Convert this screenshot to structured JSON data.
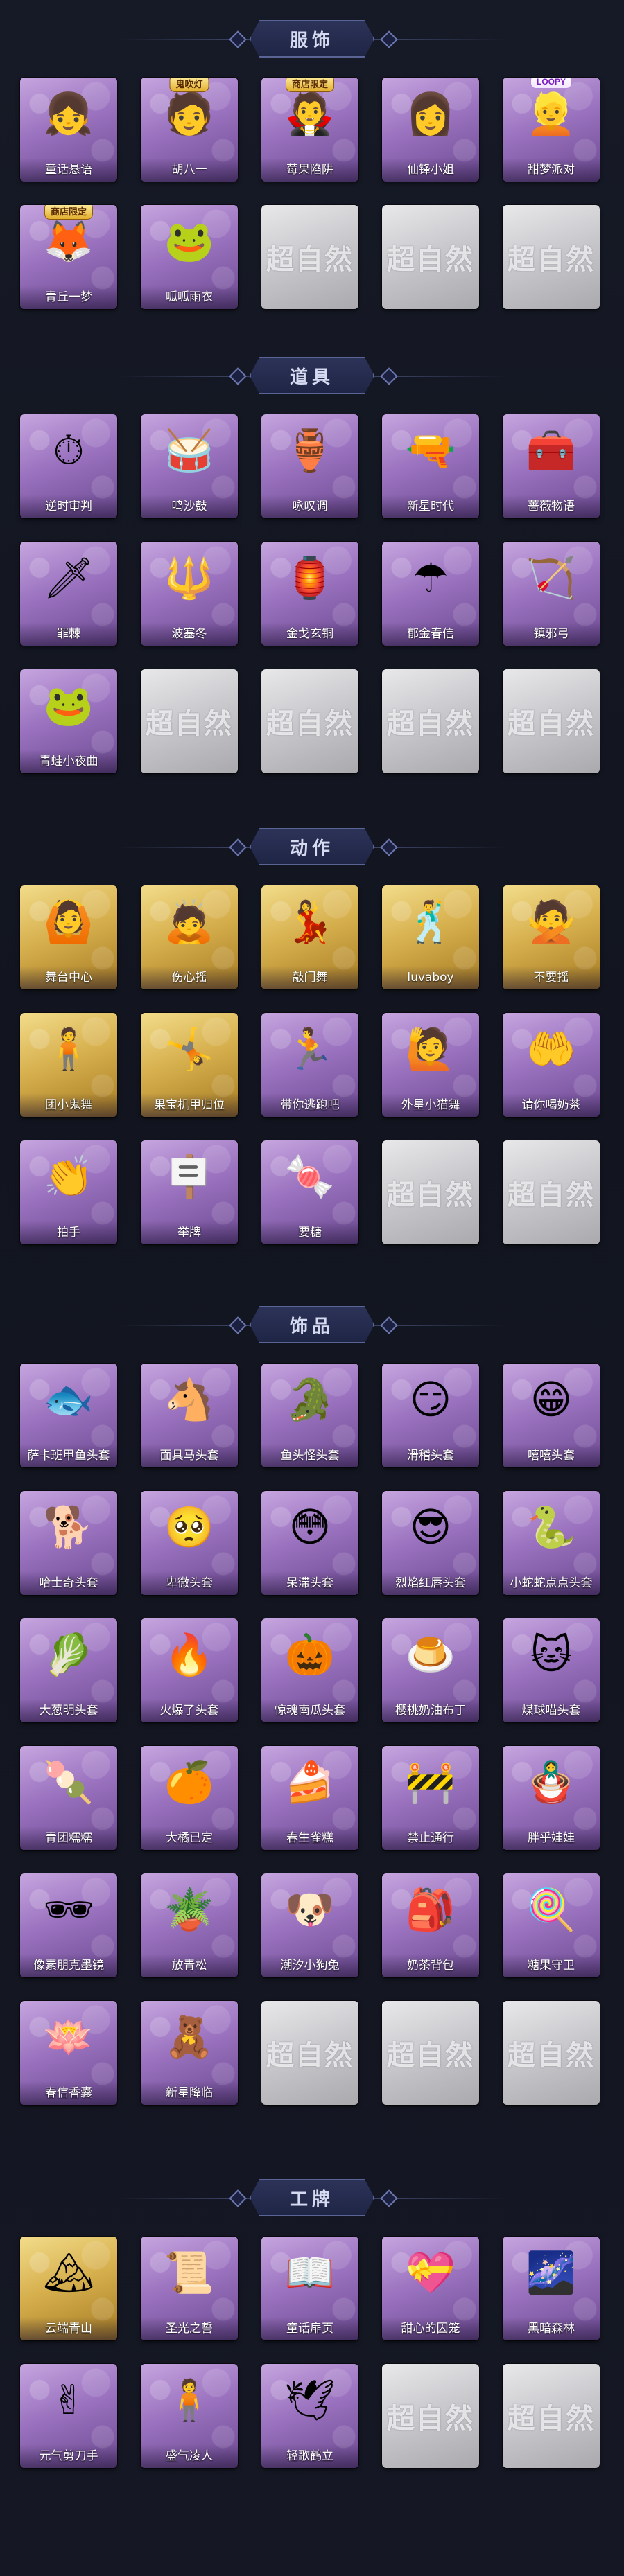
{
  "watermark": "超自然",
  "sections": [
    {
      "title": "服饰",
      "items": [
        {
          "label": "童话悬语",
          "style": "purple",
          "icon": "girl-portrait-icon",
          "glyph": "👧"
        },
        {
          "label": "胡八一",
          "style": "purple",
          "icon": "man-portrait-icon",
          "glyph": "🧑",
          "badge": "鬼吹灯"
        },
        {
          "label": "莓果陷阱",
          "style": "purple",
          "icon": "hooded-portrait-icon",
          "glyph": "🧛",
          "badge": "商店限定"
        },
        {
          "label": "仙锋小姐",
          "style": "purple",
          "icon": "lady-portrait-icon",
          "glyph": "👩"
        },
        {
          "label": "甜梦派对",
          "style": "purple",
          "icon": "party-girl-portrait-icon",
          "glyph": "👱",
          "badge": "LOOPY"
        },
        {
          "label": "青丘一梦",
          "style": "purple",
          "icon": "fox-girl-portrait-icon",
          "glyph": "🦊",
          "badge": "商店限定"
        },
        {
          "label": "呱呱雨衣",
          "style": "purple",
          "icon": "raincoat-portrait-icon",
          "glyph": "🐸"
        },
        {
          "label": "",
          "style": "empty"
        },
        {
          "label": "",
          "style": "empty"
        },
        {
          "label": "",
          "style": "empty"
        }
      ]
    },
    {
      "title": "道具",
      "items": [
        {
          "label": "逆时审判",
          "style": "purple",
          "icon": "clock-icon",
          "glyph": "⏱"
        },
        {
          "label": "鸣沙鼓",
          "style": "purple",
          "icon": "drum-icon",
          "glyph": "🥁"
        },
        {
          "label": "咏叹调",
          "style": "purple",
          "icon": "music-box-icon",
          "glyph": "🏺"
        },
        {
          "label": "新星时代",
          "style": "purple",
          "icon": "revolver-icon",
          "glyph": "🔫"
        },
        {
          "label": "蔷薇物语",
          "style": "purple",
          "icon": "medkit-icon",
          "glyph": "🧰"
        },
        {
          "label": "罪棘",
          "style": "purple",
          "icon": "spear-icon",
          "glyph": "🗡"
        },
        {
          "label": "波塞冬",
          "style": "purple",
          "icon": "trident-icon",
          "glyph": "🔱"
        },
        {
          "label": "金戈玄铜",
          "style": "purple",
          "icon": "lantern-icon",
          "glyph": "🏮"
        },
        {
          "label": "郁金春信",
          "style": "purple",
          "icon": "umbrella-icon",
          "glyph": "☂"
        },
        {
          "label": "镇邪弓",
          "style": "purple",
          "icon": "bow-icon",
          "glyph": "🏹"
        },
        {
          "label": "青蛙小夜曲",
          "style": "purple",
          "icon": "frog-icon",
          "glyph": "🐸"
        },
        {
          "label": "",
          "style": "empty"
        },
        {
          "label": "",
          "style": "empty"
        },
        {
          "label": "",
          "style": "empty"
        },
        {
          "label": "",
          "style": "empty"
        }
      ]
    },
    {
      "title": "动作",
      "items": [
        {
          "label": "舞台中心",
          "style": "gold",
          "icon": "pose-center-icon",
          "glyph": "🙆"
        },
        {
          "label": "伤心摇",
          "style": "gold",
          "icon": "pose-sad-icon",
          "glyph": "🙇"
        },
        {
          "label": "敲门舞",
          "style": "gold",
          "icon": "pose-knock-icon",
          "glyph": "💃"
        },
        {
          "label": "luvaboy",
          "style": "gold",
          "icon": "pose-heart-icon",
          "glyph": "🕺"
        },
        {
          "label": "不要摇",
          "style": "gold",
          "icon": "pose-shake-icon",
          "glyph": "🙅"
        },
        {
          "label": "团小鬼舞",
          "style": "gold",
          "icon": "pose-ghost-dance-icon",
          "glyph": "🧍"
        },
        {
          "label": "果宝机甲归位",
          "style": "gold",
          "icon": "pose-mecha-icon",
          "glyph": "🤸"
        },
        {
          "label": "带你逃跑吧",
          "style": "purple",
          "icon": "pose-run-icon",
          "glyph": "🏃"
        },
        {
          "label": "外星小猫舞",
          "style": "purple",
          "icon": "pose-cat-icon",
          "glyph": "🙋"
        },
        {
          "label": "请你喝奶茶",
          "style": "purple",
          "icon": "pose-tea-icon",
          "glyph": "🤲"
        },
        {
          "label": "拍手",
          "style": "purple",
          "icon": "pose-clap-icon",
          "glyph": "👏"
        },
        {
          "label": "举牌",
          "style": "purple",
          "icon": "pose-sign-icon",
          "glyph": "🪧"
        },
        {
          "label": "要糖",
          "style": "purple",
          "icon": "pose-candy-icon",
          "glyph": "🍬"
        },
        {
          "label": "",
          "style": "empty"
        },
        {
          "label": "",
          "style": "empty"
        }
      ]
    },
    {
      "title": "饰品",
      "items": [
        {
          "label": "萨卡班甲鱼头套",
          "style": "purple",
          "icon": "fish-head-icon",
          "glyph": "🐟"
        },
        {
          "label": "面具马头套",
          "style": "purple",
          "icon": "horse-head-icon",
          "glyph": "🐴"
        },
        {
          "label": "鱼头怪头套",
          "style": "purple",
          "icon": "fish-monster-head-icon",
          "glyph": "🐊"
        },
        {
          "label": "滑稽头套",
          "style": "purple",
          "icon": "funny-face-icon",
          "glyph": "😏"
        },
        {
          "label": "嘻嘻头套",
          "style": "purple",
          "icon": "grin-face-icon",
          "glyph": "😁"
        },
        {
          "label": "哈士奇头套",
          "style": "purple",
          "icon": "husky-head-icon",
          "glyph": "🐕"
        },
        {
          "label": "卑微头套",
          "style": "purple",
          "icon": "humble-face-icon",
          "glyph": "🥺"
        },
        {
          "label": "呆滞头套",
          "style": "purple",
          "icon": "dazed-face-icon",
          "glyph": "😳"
        },
        {
          "label": "烈焰红唇头套",
          "style": "purple",
          "icon": "red-lips-face-icon",
          "glyph": "😎"
        },
        {
          "label": "小蛇蛇点点头套",
          "style": "purple",
          "icon": "snake-head-icon",
          "glyph": "🐍"
        },
        {
          "label": "大葱明头套",
          "style": "purple",
          "icon": "scallion-head-icon",
          "glyph": "🥬"
        },
        {
          "label": "火爆了头套",
          "style": "purple",
          "icon": "fire-head-icon",
          "glyph": "🔥"
        },
        {
          "label": "惊魂南瓜头套",
          "style": "purple",
          "icon": "pumpkin-head-icon",
          "glyph": "🎃"
        },
        {
          "label": "樱桃奶油布丁",
          "style": "purple",
          "icon": "pudding-head-icon",
          "glyph": "🍮"
        },
        {
          "label": "煤球喵头套",
          "style": "purple",
          "icon": "black-cat-head-icon",
          "glyph": "🐱"
        },
        {
          "label": "青团糯糯",
          "style": "purple",
          "icon": "rice-cake-head-icon",
          "glyph": "🍡"
        },
        {
          "label": "大橘已定",
          "style": "purple",
          "icon": "orange-head-icon",
          "glyph": "🍊"
        },
        {
          "label": "春生雀糕",
          "style": "purple",
          "icon": "bird-cake-head-icon",
          "glyph": "🍰"
        },
        {
          "label": "禁止通行",
          "style": "purple",
          "icon": "traffic-cone-icon",
          "glyph": "🚧"
        },
        {
          "label": "胖乎娃娃",
          "style": "purple",
          "icon": "doll-head-icon",
          "glyph": "🪆"
        },
        {
          "label": "像素朋克墨镜",
          "style": "purple",
          "icon": "pixel-sunglasses-icon",
          "glyph": "🕶"
        },
        {
          "label": "放青松",
          "style": "purple",
          "icon": "bonsai-icon",
          "glyph": "🪴"
        },
        {
          "label": "潮汐小狗兔",
          "style": "purple",
          "icon": "blue-pet-icon",
          "glyph": "🐶"
        },
        {
          "label": "奶茶背包",
          "style": "purple",
          "icon": "milk-tea-backpack-icon",
          "glyph": "🎒"
        },
        {
          "label": "糖果守卫",
          "style": "purple",
          "icon": "candy-guard-icon",
          "glyph": "🍭"
        },
        {
          "label": "春信香囊",
          "style": "purple",
          "icon": "sachet-icon",
          "glyph": "🪷"
        },
        {
          "label": "新星降临",
          "style": "purple",
          "icon": "star-doll-icon",
          "glyph": "🧸"
        },
        {
          "label": "",
          "style": "empty"
        },
        {
          "label": "",
          "style": "empty"
        },
        {
          "label": "",
          "style": "empty"
        }
      ]
    },
    {
      "title": "工牌",
      "items": [
        {
          "label": "云端青山",
          "style": "gold",
          "icon": "badge-mountain-icon",
          "glyph": "🏔"
        },
        {
          "label": "圣光之誓",
          "style": "purple",
          "icon": "badge-holy-icon",
          "glyph": "📜"
        },
        {
          "label": "童话扉页",
          "style": "purple",
          "icon": "badge-book-icon",
          "glyph": "📖"
        },
        {
          "label": "甜心的囚笼",
          "style": "purple",
          "icon": "badge-cage-icon",
          "glyph": "💝"
        },
        {
          "label": "黑暗森林",
          "style": "purple",
          "icon": "badge-forest-icon",
          "glyph": "🌌"
        },
        {
          "label": "元气剪刀手",
          "style": "purple",
          "icon": "badge-peace-icon",
          "glyph": "✌"
        },
        {
          "label": "盛气凌人",
          "style": "purple",
          "icon": "badge-proud-icon",
          "glyph": "🧍"
        },
        {
          "label": "轻歌鹤立",
          "style": "purple",
          "icon": "badge-crane-icon",
          "glyph": "🕊"
        },
        {
          "label": "",
          "style": "empty"
        },
        {
          "label": "",
          "style": "empty"
        }
      ]
    }
  ]
}
